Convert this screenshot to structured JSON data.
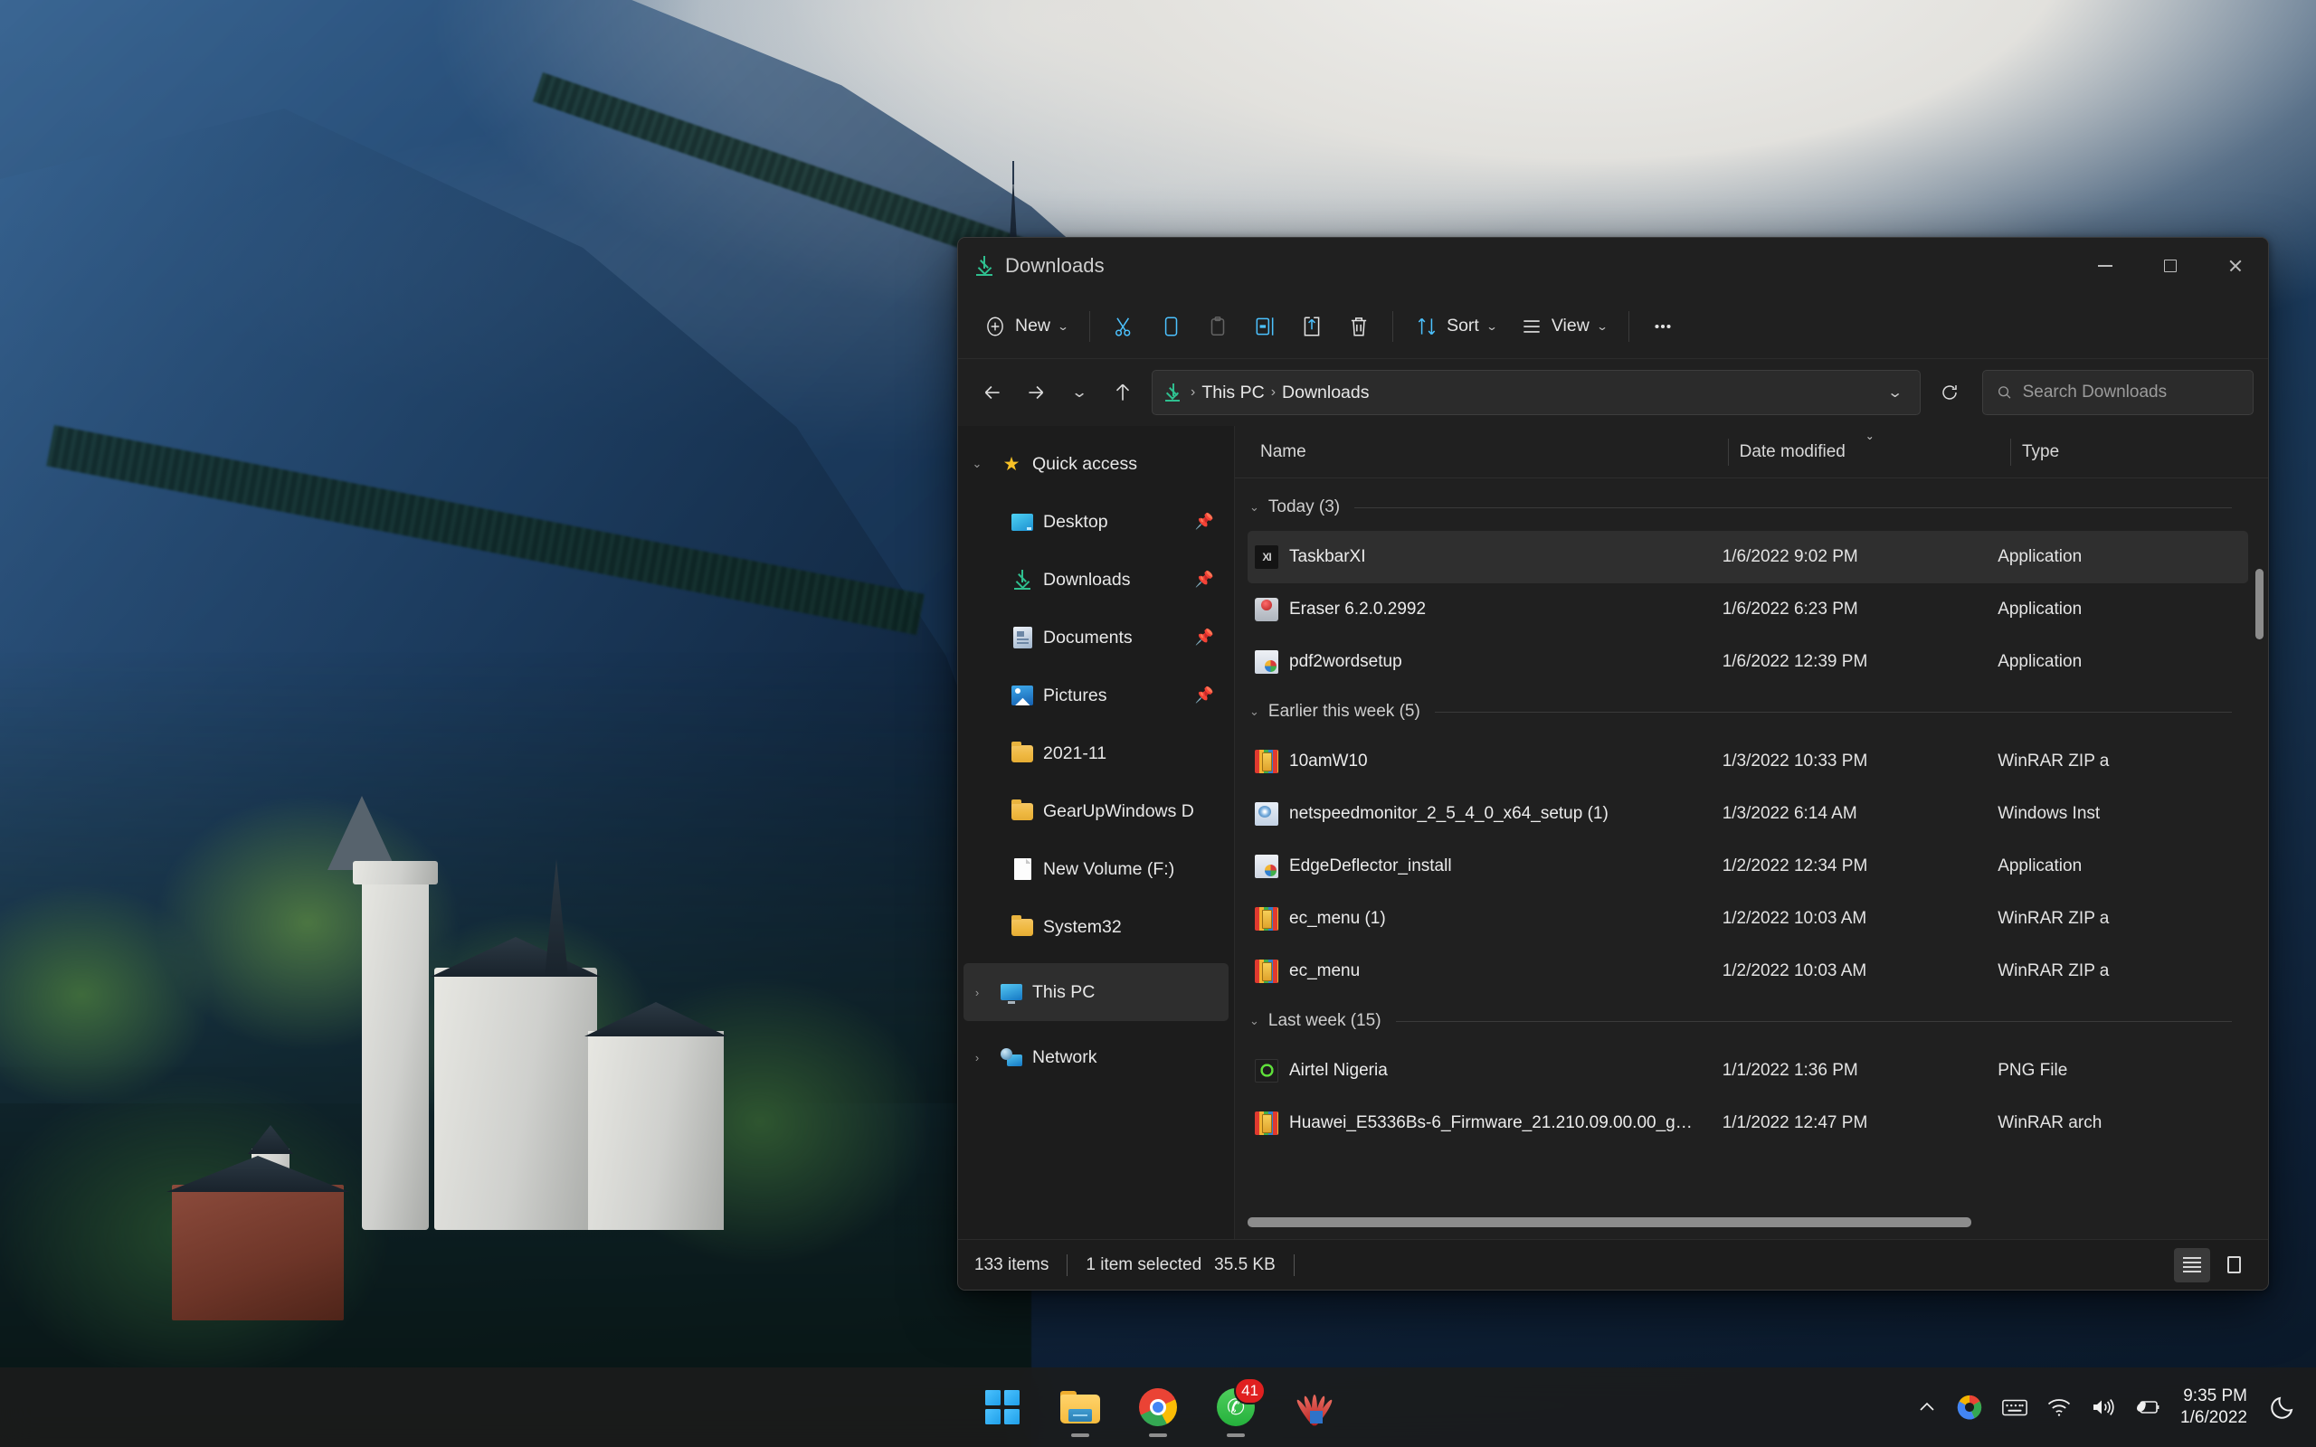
{
  "desktop": {
    "wallpaper_name": "neuschwanstein-castle-wallpaper"
  },
  "window": {
    "title": "Downloads",
    "title_icon": "downloads-icon",
    "controls": {
      "minimize": "minimize-button",
      "maximize": "maximize-button",
      "close": "close-button"
    }
  },
  "toolbar": {
    "new_label": "New",
    "sort_label": "Sort",
    "view_label": "View",
    "items": [
      {
        "name": "new-button",
        "label": "New",
        "icon": "plus-circle-icon",
        "has_chevron": true
      },
      {
        "name": "cut-button",
        "label": "Cut",
        "icon": "scissors-icon"
      },
      {
        "name": "copy-button",
        "label": "Copy",
        "icon": "copy-icon"
      },
      {
        "name": "paste-button",
        "label": "Paste",
        "icon": "clipboard-icon",
        "disabled": true
      },
      {
        "name": "rename-button",
        "label": "Rename",
        "icon": "rename-icon"
      },
      {
        "name": "share-button",
        "label": "Share",
        "icon": "share-icon"
      },
      {
        "name": "delete-button",
        "label": "Delete",
        "icon": "trash-icon"
      },
      {
        "name": "sort-button",
        "label": "Sort",
        "icon": "sort-arrows-icon",
        "has_chevron": true
      },
      {
        "name": "view-button",
        "label": "View",
        "icon": "view-lines-icon",
        "has_chevron": true
      },
      {
        "name": "see-more-button",
        "label": "See more",
        "icon": "ellipsis-icon"
      }
    ]
  },
  "nav": {
    "back": "back-arrow-icon",
    "forward": "forward-arrow-icon",
    "recent": "chevron-down-icon",
    "up": "up-arrow-icon",
    "breadcrumb": {
      "icon": "downloads-icon",
      "parts": [
        "This PC",
        "Downloads"
      ],
      "separator": "›"
    },
    "address_dropdown": "chevron-down-icon",
    "refresh": "refresh-icon"
  },
  "search": {
    "placeholder": "Search Downloads",
    "value": "",
    "icon": "search-icon"
  },
  "sidebar": {
    "groups": [
      {
        "label": "Quick access",
        "icon": "star-icon",
        "expanded": true,
        "chevron": "chevron-down-icon",
        "items": [
          {
            "label": "Desktop",
            "icon": "desktop-icon",
            "pinned": true
          },
          {
            "label": "Downloads",
            "icon": "downloads-icon",
            "pinned": true
          },
          {
            "label": "Documents",
            "icon": "documents-icon",
            "pinned": true
          },
          {
            "label": "Pictures",
            "icon": "pictures-icon",
            "pinned": true
          },
          {
            "label": "2021-11",
            "icon": "folder-icon",
            "pinned": false
          },
          {
            "label": "GearUpWindows D",
            "icon": "folder-icon",
            "pinned": false
          },
          {
            "label": "New Volume (F:)",
            "icon": "file-icon",
            "pinned": false
          },
          {
            "label": "System32",
            "icon": "folder-icon",
            "pinned": false
          }
        ]
      }
    ],
    "roots": [
      {
        "label": "This PC",
        "icon": "this-pc-icon",
        "chevron": "chevron-right-icon",
        "hovered": true
      },
      {
        "label": "Network",
        "icon": "network-icon",
        "chevron": "chevron-right-icon",
        "hovered": false
      }
    ]
  },
  "filelist": {
    "columns": [
      {
        "key": "name",
        "label": "Name"
      },
      {
        "key": "date",
        "label": "Date modified",
        "sorted": true,
        "sort_dir": "asc"
      },
      {
        "key": "type",
        "label": "Type"
      }
    ],
    "groups": [
      {
        "label": "Today (3)",
        "rows": [
          {
            "name": "TaskbarXI",
            "date": "1/6/2022 9:02 PM",
            "type": "Application",
            "icon": "taskbarxi-icon",
            "selected": true
          },
          {
            "name": "Eraser 6.2.0.2992",
            "date": "1/6/2022 6:23 PM",
            "type": "Application",
            "icon": "eraser-icon",
            "selected": false
          },
          {
            "name": "pdf2wordsetup",
            "date": "1/6/2022 12:39 PM",
            "type": "Application",
            "icon": "installer-icon",
            "selected": false
          }
        ]
      },
      {
        "label": "Earlier this week (5)",
        "rows": [
          {
            "name": "10amW10",
            "date": "1/3/2022 10:33 PM",
            "type": "WinRAR ZIP a",
            "icon": "winrar-icon",
            "selected": false
          },
          {
            "name": "netspeedmonitor_2_5_4_0_x64_setup (1)",
            "date": "1/3/2022 6:14 AM",
            "type": "Windows Inst",
            "icon": "msi-icon",
            "selected": false
          },
          {
            "name": "EdgeDeflector_install",
            "date": "1/2/2022 12:34 PM",
            "type": "Application",
            "icon": "installer-icon",
            "selected": false
          },
          {
            "name": "ec_menu (1)",
            "date": "1/2/2022 10:03 AM",
            "type": "WinRAR ZIP a",
            "icon": "winrar-icon",
            "selected": false
          },
          {
            "name": "ec_menu",
            "date": "1/2/2022 10:03 AM",
            "type": "WinRAR ZIP a",
            "icon": "winrar-icon",
            "selected": false
          }
        ]
      },
      {
        "label": "Last week (15)",
        "rows": [
          {
            "name": "Airtel Nigeria",
            "date": "1/1/2022 1:36 PM",
            "type": "PNG File",
            "icon": "png-icon",
            "selected": false
          },
          {
            "name": "Huawei_E5336Bs-6_Firmware_21.210.09.00.00_g…",
            "date": "1/1/2022 12:47 PM",
            "type": "WinRAR arch",
            "icon": "winrar-icon",
            "selected": false
          }
        ]
      }
    ]
  },
  "statusbar": {
    "item_count": "133 items",
    "selection": "1 item selected",
    "selection_size": "35.5 KB",
    "views": [
      {
        "name": "details-view-button",
        "icon": "details-view-icon",
        "active": true
      },
      {
        "name": "large-icons-view-button",
        "icon": "large-icons-view-icon",
        "active": false
      }
    ]
  },
  "taskbar": {
    "items": [
      {
        "name": "start-button",
        "icon": "windows-logo-icon",
        "running": false,
        "badge": ""
      },
      {
        "name": "file-explorer-taskbar-button",
        "icon": "folder-icon",
        "running": true,
        "badge": ""
      },
      {
        "name": "chrome-taskbar-button",
        "icon": "chrome-icon",
        "running": true,
        "badge": ""
      },
      {
        "name": "whatsapp-taskbar-button",
        "icon": "whatsapp-icon",
        "running": true,
        "badge": "41"
      },
      {
        "name": "huawei-taskbar-button",
        "icon": "huawei-icon",
        "running": false,
        "badge": ""
      }
    ],
    "tray": [
      {
        "name": "show-hidden-icons-button",
        "icon": "chevron-up-icon"
      },
      {
        "name": "edge-tray-icon",
        "icon": "edge-icon"
      },
      {
        "name": "touch-keyboard-button",
        "icon": "keyboard-icon"
      },
      {
        "name": "network-tray-button",
        "icon": "wifi-icon"
      },
      {
        "name": "volume-tray-button",
        "icon": "speaker-icon"
      },
      {
        "name": "battery-tray-button",
        "icon": "battery-eco-icon"
      }
    ],
    "clock": {
      "time": "9:35 PM",
      "date": "1/6/2022"
    },
    "notifications": {
      "icon": "moon-icon"
    }
  },
  "colors": {
    "accent_blue": "#4cc2ff",
    "download_green": "#2fbf8f",
    "window_bg": "#202020",
    "sidebar_bg": "#1c1c1c",
    "badge_red": "#e02020"
  }
}
